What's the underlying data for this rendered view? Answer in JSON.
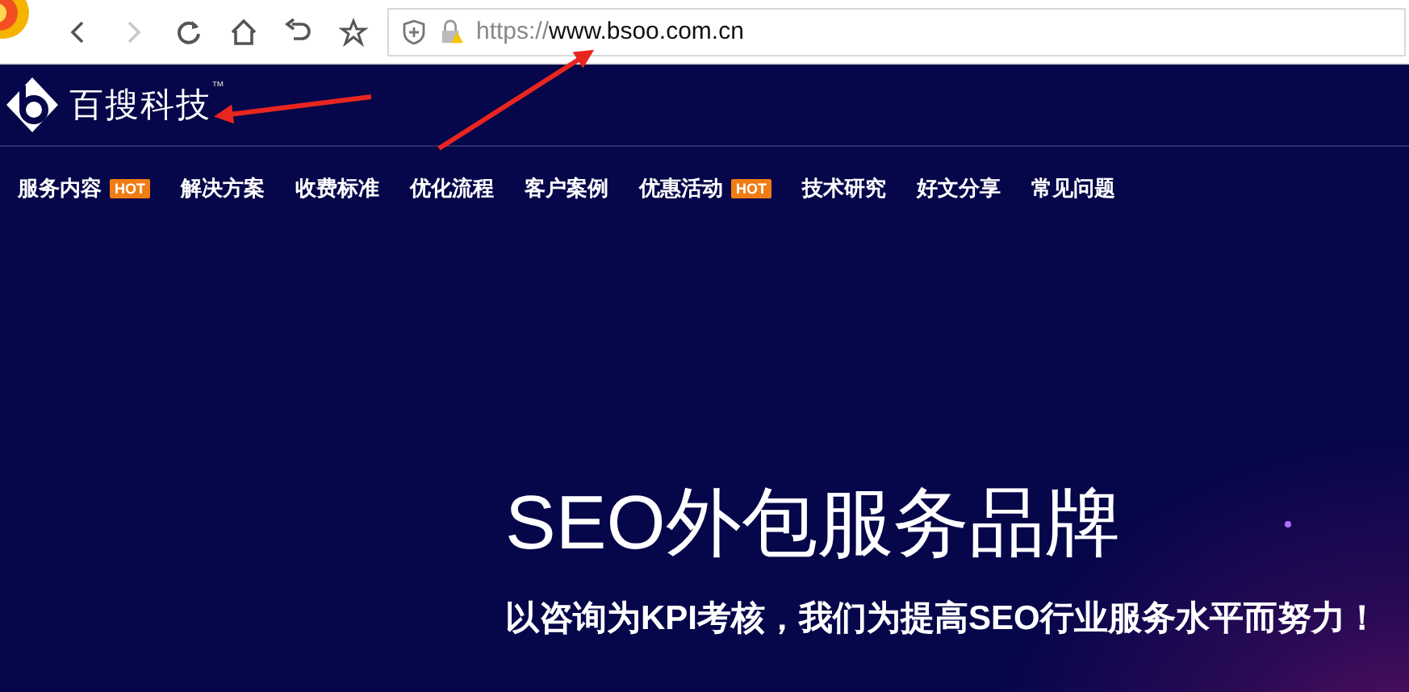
{
  "browser": {
    "buttons": [
      {
        "kind": "back",
        "disabled": false
      },
      {
        "kind": "forward",
        "disabled": true
      },
      {
        "kind": "reload",
        "disabled": false
      },
      {
        "kind": "home",
        "disabled": false
      },
      {
        "kind": "undo",
        "disabled": false
      },
      {
        "kind": "star",
        "disabled": false
      }
    ],
    "url_scheme": "https://",
    "url_host": "www.bsoo.com.cn"
  },
  "site": {
    "brand": "百搜科技",
    "trademark": "™"
  },
  "nav": [
    {
      "label": "服务内容",
      "badge": "HOT"
    },
    {
      "label": "解决方案"
    },
    {
      "label": "收费标准"
    },
    {
      "label": "优化流程"
    },
    {
      "label": "客户案例"
    },
    {
      "label": "优惠活动",
      "badge": "HOT"
    },
    {
      "label": "技术研究"
    },
    {
      "label": "好文分享"
    },
    {
      "label": "常见问题"
    }
  ],
  "hero": {
    "title": "SEO外包服务品牌",
    "subtitle": "以咨询为KPI考核，我们为提高SEO行业服务水平而努力！"
  }
}
